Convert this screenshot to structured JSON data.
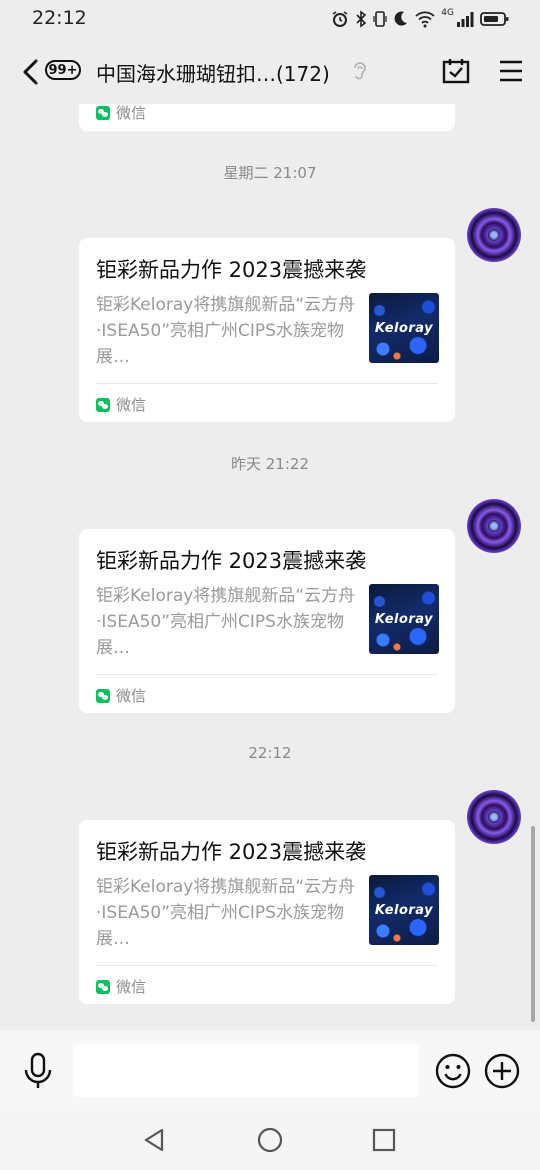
{
  "status_bar": {
    "time": "22:12",
    "network": "4G"
  },
  "header": {
    "unread_badge": "99+",
    "title": "中国海水珊瑚钮扣…(172)"
  },
  "messages": {
    "partial_card": {
      "source": "微信"
    },
    "groups": [
      {
        "timestamp": "星期二 21:07",
        "card": {
          "title": "钜彩新品力作 2023震撼来袭",
          "description": "钜彩Keloray将携旗舰新品“云方舟·ISEA50”亮相广州CIPS水族宠物展…",
          "thumb_text": "Keloray",
          "source": "微信"
        }
      },
      {
        "timestamp": "昨天 21:22",
        "card": {
          "title": "钜彩新品力作 2023震撼来袭",
          "description": "钜彩Keloray将携旗舰新品“云方舟·ISEA50”亮相广州CIPS水族宠物展…",
          "thumb_text": "Keloray",
          "source": "微信"
        }
      },
      {
        "timestamp": "22:12",
        "card": {
          "title": "钜彩新品力作 2023震撼来袭",
          "description": "钜彩Keloray将携旗舰新品“云方舟·ISEA50”亮相广州CIPS水族宠物展…",
          "thumb_text": "Keloray",
          "source": "微信"
        }
      }
    ]
  },
  "input_bar": {
    "placeholder": ""
  },
  "colors": {
    "background": "#ededed",
    "wechat_green": "#07c160",
    "card": "#ffffff"
  }
}
